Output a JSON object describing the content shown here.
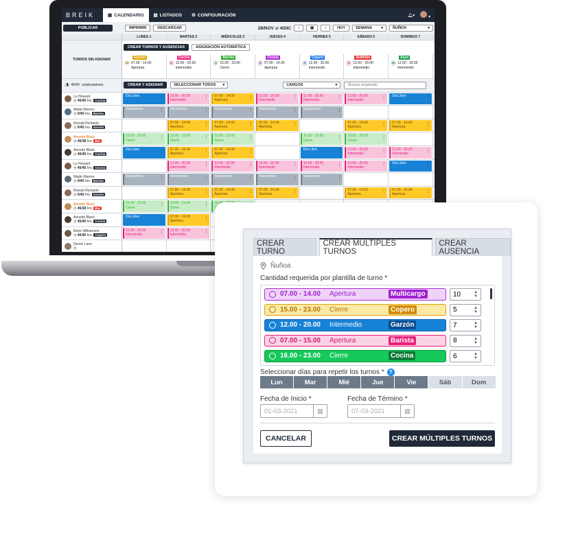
{
  "app": {
    "brand": "BREIK"
  },
  "nav": {
    "tabs": [
      "CALENDARIO",
      "LISTADOS",
      "CONFIGURACIÓN"
    ]
  },
  "toolbar": {
    "publish": "PUBLICAR",
    "print": "IMPRIMIR",
    "download": "DESCARGAR",
    "date_from": "28/NOV",
    "date_sep": "al",
    "date_to": "4/DIC",
    "today": "HOY",
    "view": "SEMANA",
    "location": "ÑUÑOA"
  },
  "schedule": {
    "days": [
      "LUNES 1",
      "MARTES 2",
      "MIÉRCOLES 3",
      "JUEVES 4",
      "VIERNES 5",
      "SÁBADO 6",
      "DOMINGO 7"
    ],
    "unassigned_label": "TURNOS SIN ASIGNAR",
    "create_shifts_btn": "CREAR TURNOS Y AUSENCIAS",
    "auto_assign_btn": "ASIGNACIÓN AUTOMÁTICA",
    "unassigned": [
      {
        "count": "10",
        "role": "Garzón",
        "time": "07.00 - 14.00",
        "place": "Apertura",
        "color": "#e0a100"
      },
      {
        "count": "5",
        "role": "Cocina",
        "time": "12.00 - 20.00",
        "place": "Intermedio",
        "color": "#e91e7a"
      },
      {
        "count": "3",
        "role": "Barista",
        "time": "15.00 - 23.00",
        "place": "Cierre",
        "color": "#29a329"
      },
      {
        "count": "6",
        "role": "Cocina",
        "time": "07.00 - 14.00",
        "place": "Apertura",
        "color": "#b02ad6"
      },
      {
        "count": "3",
        "role": "Copero",
        "time": "12.00 - 20.00",
        "place": "Intermedio",
        "color": "#1a73e8"
      },
      {
        "count": "5",
        "role": "Anfitrión",
        "time": "12.00 - 20.00",
        "place": "Intermedio",
        "color": "#e53935"
      },
      {
        "count": "10",
        "role": "Aseo",
        "time": "12.00 - 20.00",
        "place": "Intermedio",
        "color": "#16a34a"
      }
    ],
    "collab_count": "40/40",
    "collab_label": "colaboradores",
    "create_assign_btn": "CREAR Y ASIGNAR",
    "select_all": "SELECCIONAR TODOS",
    "positions": "CARGOS",
    "search_placeholder": "Buscar empleado",
    "employees": [
      {
        "name": "Lu Howard",
        "hours": "45/45",
        "tag": "Cocina",
        "shifts": [
          "libre",
          "interm",
          "apert",
          "interm",
          "interm",
          "interm",
          "libre"
        ]
      },
      {
        "name": "Wade Warren",
        "hours": "0/45",
        "tag": "Barista",
        "shifts": [
          "vac",
          "vac",
          "vac",
          "vac",
          "vac",
          "",
          ""
        ]
      },
      {
        "name": "Ronald Richards",
        "hours": "0/45",
        "tag": "Garzón",
        "shifts": [
          "",
          "apert",
          "apert",
          "apert",
          "",
          "apert",
          "apert"
        ]
      },
      {
        "name": "Annette Black",
        "hours": "45/38",
        "tag": "Bar",
        "shifts": [
          "cierre",
          "cierre",
          "cierre",
          "",
          "cierre",
          "cierre",
          ""
        ]
      },
      {
        "name": "Annette Black",
        "hours": "45/45",
        "tag": "Cocina",
        "shifts": [
          "libre",
          "apert",
          "apert",
          "",
          "libre",
          "interm",
          "interm"
        ]
      },
      {
        "name": "Lu Howard",
        "hours": "45/45",
        "tag": "Cocina",
        "shifts": [
          "",
          "interm",
          "interm",
          "interm",
          "interm",
          "interm",
          "libre"
        ]
      },
      {
        "name": "Wade Warren",
        "hours": "0/45",
        "tag": "Barista",
        "shifts": [
          "vac",
          "vac",
          "vac",
          "vac",
          "vac",
          "",
          ""
        ]
      },
      {
        "name": "Ronald Richards",
        "hours": "0/45",
        "tag": "Garzón",
        "shifts": [
          "",
          "apert",
          "apert",
          "apert",
          "",
          "apert",
          "apert"
        ]
      },
      {
        "name": "Annette Black",
        "hours": "45/38",
        "tag": "Bar",
        "shifts": [
          "cierre",
          "cierre",
          "cierre",
          "",
          "",
          "",
          ""
        ]
      },
      {
        "name": "Annette Black",
        "hours": "45/45",
        "tag": "Cocina",
        "shifts": [
          "libre",
          "apert",
          "",
          "",
          "",
          "",
          ""
        ]
      },
      {
        "name": "Rene Williamson",
        "hours": "40/45",
        "tag": "Copero",
        "shifts": [
          "interm",
          "interm",
          "",
          "",
          "",
          "",
          ""
        ]
      },
      {
        "name": "Devon Lane",
        "hours": "",
        "tag": "",
        "shifts": [
          "",
          "",
          "",
          "",
          "",
          "",
          ""
        ]
      }
    ],
    "shift_types": {
      "libre": {
        "label": "Día Libre",
        "sub": "",
        "color": "#1782d6"
      },
      "interm": {
        "label": "12.00 - 20.00",
        "sub": "Intermedio",
        "color": "#e91e7a"
      },
      "apert": {
        "label": "07.00 - 14.00",
        "sub": "Apertura",
        "color": "#e0a100"
      },
      "cierre": {
        "label": "15.00 - 23.00",
        "sub": "Cierre",
        "color": "#2eb82e"
      },
      "vac": {
        "label": "Vacaciones",
        "sub": "",
        "color": "#6c7a89"
      }
    }
  },
  "modal": {
    "tabs": [
      "CREAR TURNO",
      "CREAR MÚLTIPLES TURNOS",
      "CREAR AUSENCIA"
    ],
    "location": "Ñuñoa",
    "qty_label": "Cantidad requerida por plantilla de turno *",
    "templates": [
      {
        "time": "07.00 - 14.00",
        "place": "Apertura",
        "role": "Multicargo",
        "qty": "10",
        "bg": "#efd3f7",
        "border": "#b02ad6",
        "roleColor": "#a020d0",
        "text": "#a020d0"
      },
      {
        "time": "15.00 - 23.00",
        "place": "Cierre",
        "role": "Copero",
        "qty": "5",
        "bg": "#fbe9a6",
        "border": "#e0a100",
        "roleColor": "#d48a00",
        "text": "#b37600"
      },
      {
        "time": "12.00 - 20.00",
        "place": "Intermedio",
        "role": "Garzón",
        "qty": "7",
        "bg": "#1782d6",
        "border": "#1466b0",
        "roleColor": "#0b4f8f",
        "text": "#ffffff"
      },
      {
        "time": "07.00 - 15.00",
        "place": "Apertura",
        "role": "Barista",
        "qty": "8",
        "bg": "#fbd3e6",
        "border": "#e91e7a",
        "roleColor": "#e91e7a",
        "text": "#d4186e"
      },
      {
        "time": "16.00 - 23.00",
        "place": "Cierre",
        "role": "Cocina",
        "qty": "6",
        "bg": "#16c95a",
        "border": "#0e9a43",
        "roleColor": "#0b7a35",
        "text": "#ffffff"
      }
    ],
    "repeat_label": "Seleccionar días para repetir los turnos *",
    "help": "?",
    "days": [
      {
        "label": "Lun",
        "on": true
      },
      {
        "label": "Mar",
        "on": true
      },
      {
        "label": "Mié",
        "on": true
      },
      {
        "label": "Jue",
        "on": true
      },
      {
        "label": "Vie",
        "on": true
      },
      {
        "label": "Sáb",
        "on": false
      },
      {
        "label": "Dom",
        "on": false
      }
    ],
    "start_label": "Fecha de Inicio *",
    "start_value": "01-03-2021",
    "end_label": "Fecha de Término *",
    "end_value": "07-03-2021",
    "cancel": "CANCELAR",
    "submit": "CREAR MÚLTIPLES TURNOS"
  }
}
